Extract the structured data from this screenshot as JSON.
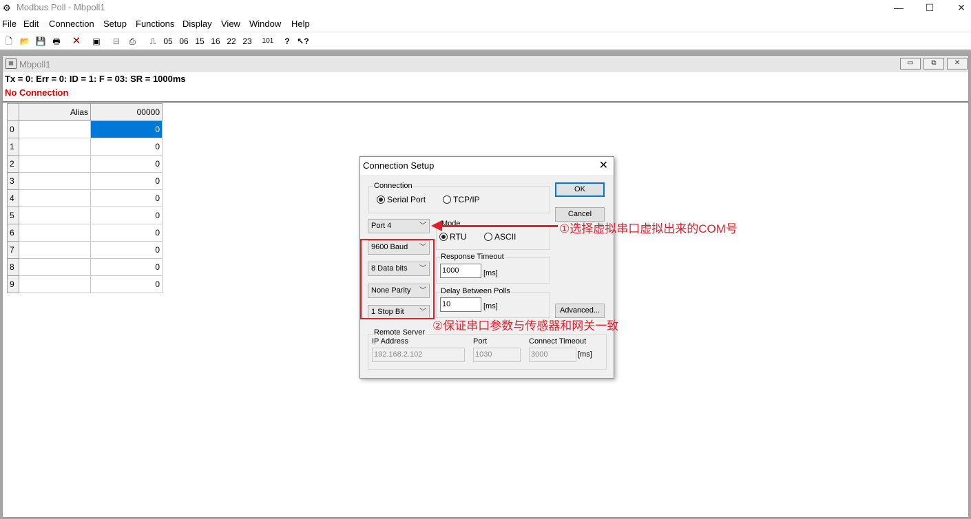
{
  "window": {
    "title": "Modbus Poll - Mbpoll1",
    "minimize": "—",
    "maximize": "☐",
    "close": "✕"
  },
  "menu": [
    "File",
    "Edit",
    "Connection",
    "Setup",
    "Functions",
    "Display",
    "View",
    "Window",
    "Help"
  ],
  "toolbar": {
    "f05": "05",
    "f06": "06",
    "f15": "15",
    "f16": "16",
    "f22": "22",
    "f23": "23",
    "f101": "101"
  },
  "child": {
    "title": "Mbpoll1",
    "status_line": "Tx = 0: Err = 0: ID = 1: F = 03: SR = 1000ms",
    "connection_status": "No Connection"
  },
  "grid": {
    "headers": [
      "Alias",
      "00000"
    ],
    "rows": [
      {
        "idx": "0",
        "alias": "",
        "value": "0"
      },
      {
        "idx": "1",
        "alias": "",
        "value": "0"
      },
      {
        "idx": "2",
        "alias": "",
        "value": "0"
      },
      {
        "idx": "3",
        "alias": "",
        "value": "0"
      },
      {
        "idx": "4",
        "alias": "",
        "value": "0"
      },
      {
        "idx": "5",
        "alias": "",
        "value": "0"
      },
      {
        "idx": "6",
        "alias": "",
        "value": "0"
      },
      {
        "idx": "7",
        "alias": "",
        "value": "0"
      },
      {
        "idx": "8",
        "alias": "",
        "value": "0"
      },
      {
        "idx": "9",
        "alias": "",
        "value": "0"
      }
    ]
  },
  "dialog": {
    "title": "Connection Setup",
    "connection_group": "Connection",
    "serial_port": "Serial Port",
    "tcpip": "TCP/IP",
    "ok": "OK",
    "cancel": "Cancel",
    "port": "Port 4",
    "mode_group": "Mode",
    "rtu": "RTU",
    "ascii": "ASCII",
    "baud": "9600 Baud",
    "data_bits": "8 Data bits",
    "parity": "None Parity",
    "stop_bits": "1 Stop Bit",
    "response_timeout_label": "Response Timeout",
    "response_timeout": "1000",
    "ms": "[ms]",
    "delay_label": "Delay Between Polls",
    "delay": "10",
    "advanced": "Advanced...",
    "remote_server_group": "Remote Server",
    "ip_label": "IP Address",
    "ip": "192.168.2.102",
    "port_label": "Port",
    "tcp_port": "1030",
    "connect_timeout_label": "Connect Timeout",
    "connect_timeout": "3000"
  },
  "annotations": {
    "note1": "①选择虚拟串口虚拟出来的COM号",
    "note2": "②保证串口参数与传感器和网关一致"
  },
  "colors": {
    "annotation": "#e0202a",
    "selection": "#0078d7",
    "no_connection": "#e00000"
  }
}
